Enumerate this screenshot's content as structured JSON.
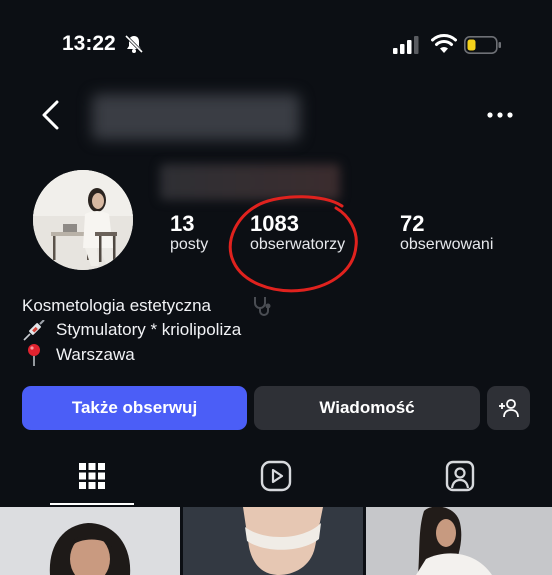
{
  "status_bar": {
    "time": "13:22",
    "icons": [
      "bell-off-icon",
      "signal-icon",
      "wifi-icon",
      "battery-icon"
    ]
  },
  "nav": {
    "back_icon": "chevron-left-icon",
    "more_icon": "more-horizontal-icon"
  },
  "profile": {
    "stats": {
      "posts_count": "13",
      "posts_label": "posty",
      "followers_count": "1083",
      "followers_label": "obserwatorzy",
      "following_count": "72",
      "following_label": "obserwowani"
    },
    "bio": {
      "line1": "Kosmetologia estetyczna",
      "line2": "Stymulatory * kriolipoliza",
      "line3": "Warszawa"
    }
  },
  "actions": {
    "follow_label": "Także obserwuj",
    "message_label": "Wiadomość"
  },
  "tabs": [
    {
      "icon": "grid-icon",
      "active": true
    },
    {
      "icon": "reels-icon",
      "active": false
    },
    {
      "icon": "tagged-icon",
      "active": false
    }
  ],
  "colors": {
    "background": "#0c0f14",
    "primary_button": "#4b5ef7",
    "secondary_button": "#2e3036",
    "annotation_circle": "#e0221e"
  }
}
